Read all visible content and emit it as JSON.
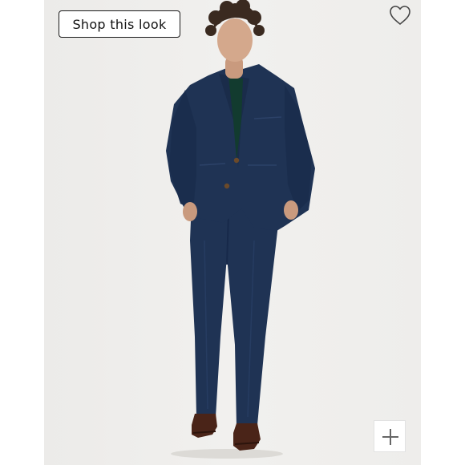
{
  "shop_button": {
    "label": "Shop this look"
  },
  "icons": {
    "favorite": "heart-outline-icon",
    "expand": "plus-icon"
  },
  "colors": {
    "suit": "#1f3354",
    "sweater": "#123b2f",
    "shoes": "#4a2418",
    "background": "#efeeec"
  }
}
